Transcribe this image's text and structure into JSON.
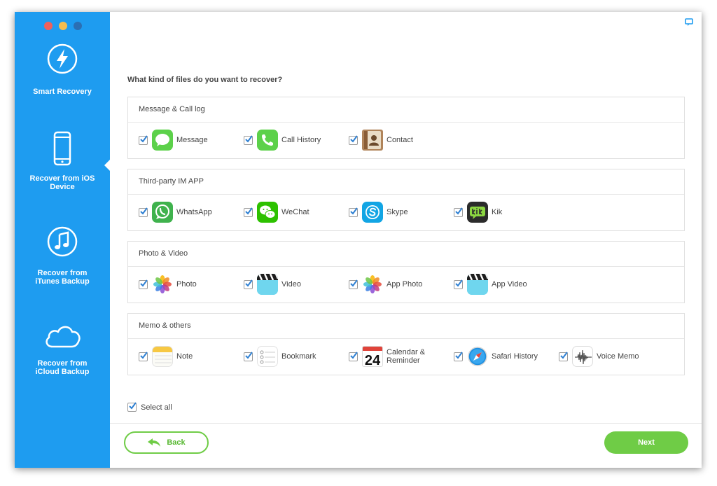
{
  "colors": {
    "sidebar": "#1e9cf0",
    "accent_green": "#6fcc46",
    "traffic_close": "#f0605a",
    "traffic_min": "#f5bd4f",
    "traffic_max": "#2b6fb3"
  },
  "sidebar": {
    "items": [
      {
        "label": "Smart Recovery",
        "icon": "lightning-icon"
      },
      {
        "label": "Recover from iOS\nDevice",
        "icon": "iphone-icon",
        "selected": true
      },
      {
        "label": "Recover from\niTunes Backup",
        "icon": "music-note-icon"
      },
      {
        "label": "Recover from\niCloud Backup",
        "icon": "cloud-icon"
      }
    ]
  },
  "main": {
    "question": "What kind of files do you want to recover?",
    "groups": [
      {
        "title": "Message & Call log",
        "items": [
          {
            "label": "Message",
            "icon": "message-icon",
            "checked": true
          },
          {
            "label": "Call History",
            "icon": "phone-icon",
            "checked": true
          },
          {
            "label": "Contact",
            "icon": "contacts-icon",
            "checked": true
          }
        ]
      },
      {
        "title": "Third-party IM APP",
        "items": [
          {
            "label": "WhatsApp",
            "icon": "whatsapp-icon",
            "checked": true
          },
          {
            "label": "WeChat",
            "icon": "wechat-icon",
            "checked": true
          },
          {
            "label": "Skype",
            "icon": "skype-icon",
            "checked": true
          },
          {
            "label": "Kik",
            "icon": "kik-icon",
            "checked": true
          }
        ]
      },
      {
        "title": "Photo & Video",
        "items": [
          {
            "label": "Photo",
            "icon": "photos-icon",
            "checked": true
          },
          {
            "label": "Video",
            "icon": "video-clapper-icon",
            "checked": true
          },
          {
            "label": "App Photo",
            "icon": "app-photos-icon",
            "checked": true
          },
          {
            "label": "App Video",
            "icon": "app-video-icon",
            "checked": true
          }
        ]
      },
      {
        "title": "Memo & others",
        "items": [
          {
            "label": "Note",
            "icon": "notes-icon",
            "checked": true
          },
          {
            "label": "Bookmark",
            "icon": "bookmark-icon",
            "checked": true
          },
          {
            "label": "Calendar &\nReminder",
            "icon": "calendar-icon",
            "calendar_day": "24",
            "checked": true
          },
          {
            "label": "Safari History",
            "icon": "safari-icon",
            "checked": true
          },
          {
            "label": "Voice Memo",
            "icon": "voice-memo-icon",
            "checked": true
          }
        ]
      }
    ],
    "select_all_label": "Select all",
    "select_all_checked": true
  },
  "footer": {
    "back_label": "Back",
    "next_label": "Next"
  }
}
